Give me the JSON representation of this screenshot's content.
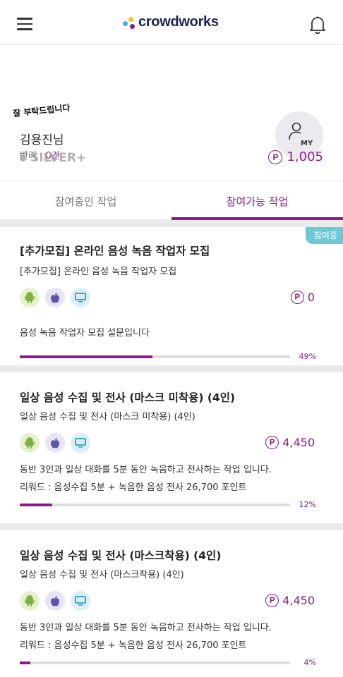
{
  "header": {
    "logo_text": "crowdworks",
    "menu_icon": "hamburger-icon",
    "bell_icon": "bell-icon"
  },
  "profile": {
    "greeting_note": "잘 부탁드립니다",
    "user_name": "김용진",
    "name_suffix": "님",
    "rejects_label": "반려 : ",
    "rejects_value": "0건",
    "avatar_label": "MY",
    "tier": "SILVER+",
    "points_icon": "P",
    "points": "1,005"
  },
  "tabs": [
    {
      "label": "참여중인 작업",
      "active": false
    },
    {
      "label": "참여가능 작업",
      "active": true
    }
  ],
  "colors": {
    "accent": "#8c1a8c",
    "badge": "#6ec9d4"
  },
  "tasks": [
    {
      "badge": "참여중",
      "title": "[추가모집] 온라인 음성 녹음 작업자 모집",
      "subtitle": "[추가모집] 온라인 음성 녹음 작업자 모집",
      "platforms": [
        "android-icon",
        "apple-icon",
        "desktop-icon"
      ],
      "reward": "0",
      "desc1": "음성 녹음 작업자 모집 설문입니다",
      "desc2": "",
      "progress": 49,
      "progress_label": "49%"
    },
    {
      "badge": "",
      "title": "일상 음성 수집 및 전사 (마스크 미착용) (4인)",
      "subtitle": "일상 음성 수집 및 전사 (마스크 미착용) (4인)",
      "platforms": [
        "android-icon",
        "apple-icon",
        "desktop-icon"
      ],
      "reward": "4,450",
      "desc1": "동반 3인과 일상 대화를 5분 동안 녹음하고 전사하는 작업 입니다.",
      "desc2": "리워드 : 음성수집 5분 + 녹음한 음성 전사 26,700 포인트",
      "progress": 12,
      "progress_label": "12%"
    },
    {
      "badge": "",
      "title": "일상 음성 수집 및 전사 (마스크착용) (4인)",
      "subtitle": "일상 음성 수집 및 전사 (마스크착용) (4인)",
      "platforms": [
        "android-icon",
        "apple-icon",
        "desktop-icon"
      ],
      "reward": "4,450",
      "desc1": "동반 3인과 일상 대화를 5분 동안 녹음하고 전사하는 작업 입니다.",
      "desc2": "리워드 : 음성수집 5분 + 녹음한 음성 전사 26,700 포인트",
      "progress": 4,
      "progress_label": "4%"
    }
  ]
}
